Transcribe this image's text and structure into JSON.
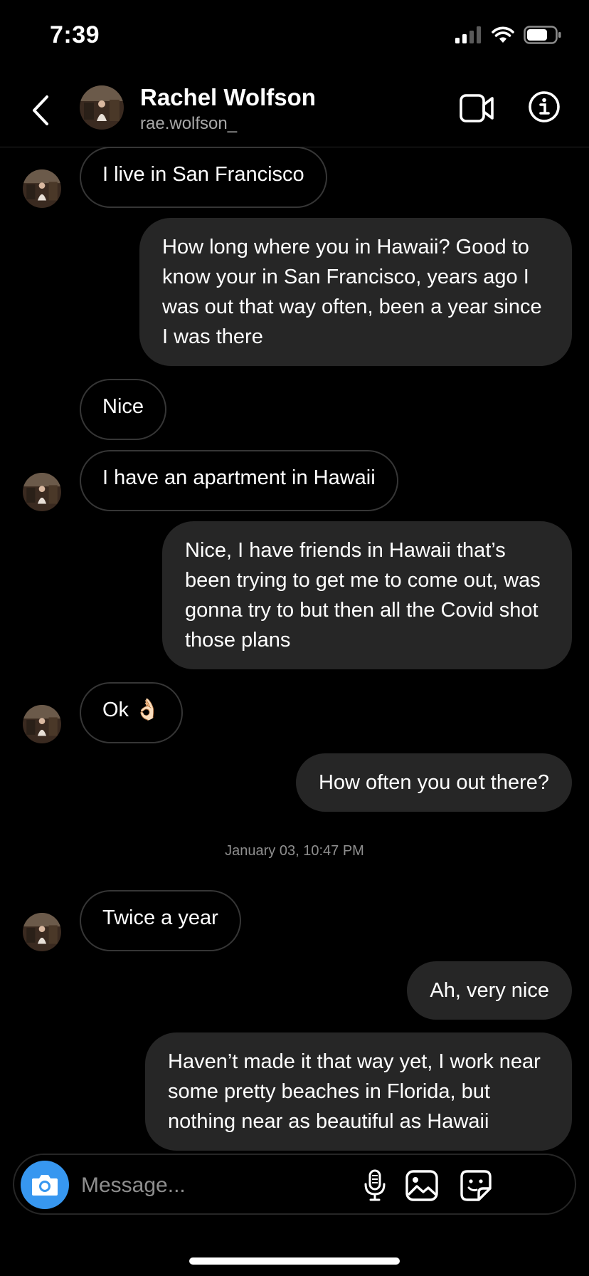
{
  "status_bar": {
    "time": "7:39"
  },
  "header": {
    "name": "Rachel Wolfson",
    "username": "rae.wolfson_"
  },
  "messages": [
    {
      "from": "them",
      "text": "I live in San Francisco"
    },
    {
      "from": "me",
      "text": "How long where you in Hawaii? Good to know your in San Francisco, years ago I was out that way often, been a year since I was there"
    },
    {
      "from": "them",
      "text": "Nice"
    },
    {
      "from": "them",
      "text": "I have an apartment in Hawaii"
    },
    {
      "from": "me",
      "text": "Nice, I have friends in Hawaii that’s been trying to get me to come out, was gonna try to but then all the Covid shot those plans"
    },
    {
      "from": "them",
      "text": "Ok 👌🏻"
    },
    {
      "from": "me",
      "text": "How often you out there?"
    },
    {
      "type": "date",
      "text": "January 03, 10:47 PM"
    },
    {
      "from": "them",
      "text": "Twice a year"
    },
    {
      "from": "me",
      "text": "Ah, very nice"
    },
    {
      "from": "me",
      "text": "Haven’t made it that way yet, I work near some pretty beaches in Florida, but nothing near as beautiful as Hawaii"
    }
  ],
  "composer": {
    "placeholder": "Message..."
  },
  "colors": {
    "accent": "#3797f0",
    "bubble_out": "#262626",
    "bubble_in_border": "#363636"
  },
  "icons": [
    "back-icon",
    "video-call-icon",
    "info-icon",
    "camera-icon",
    "microphone-icon",
    "gallery-icon",
    "sticker-icon"
  ]
}
